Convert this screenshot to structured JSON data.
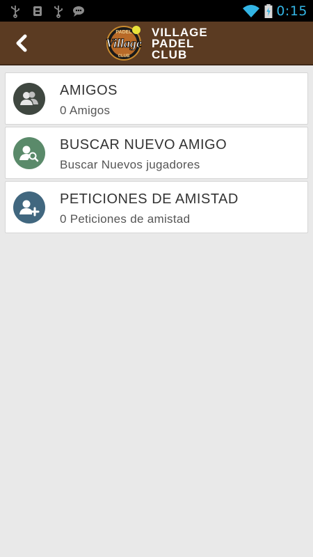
{
  "status_bar": {
    "time": "0:15",
    "left_icons": [
      "usb-icon",
      "android-debug-icon",
      "usb-icon",
      "chat-icon"
    ],
    "right_icons": [
      "wifi-icon",
      "battery-charging-icon"
    ],
    "clock_color": "#33b5e5"
  },
  "header": {
    "brand_line1": "VILLAGE",
    "brand_line2": "PADEL",
    "brand_line3": "CLUB",
    "logo_script": "Village",
    "logo_top": "PADEL",
    "logo_bottom": "CLUB",
    "background": "#5b3b22"
  },
  "menu": {
    "items": [
      {
        "title": "AMIGOS",
        "subtitle": "0 Amigos",
        "icon": "friends-icon",
        "icon_color": "#3f4740"
      },
      {
        "title": "BUSCAR NUEVO AMIGO",
        "subtitle": "Buscar Nuevos jugadores",
        "icon": "search-user-icon",
        "icon_color": "#5a8a6a"
      },
      {
        "title": "PETICIONES DE AMISTAD",
        "subtitle": "0 Peticiones de amistad",
        "icon": "add-user-icon",
        "icon_color": "#41677f"
      }
    ]
  }
}
